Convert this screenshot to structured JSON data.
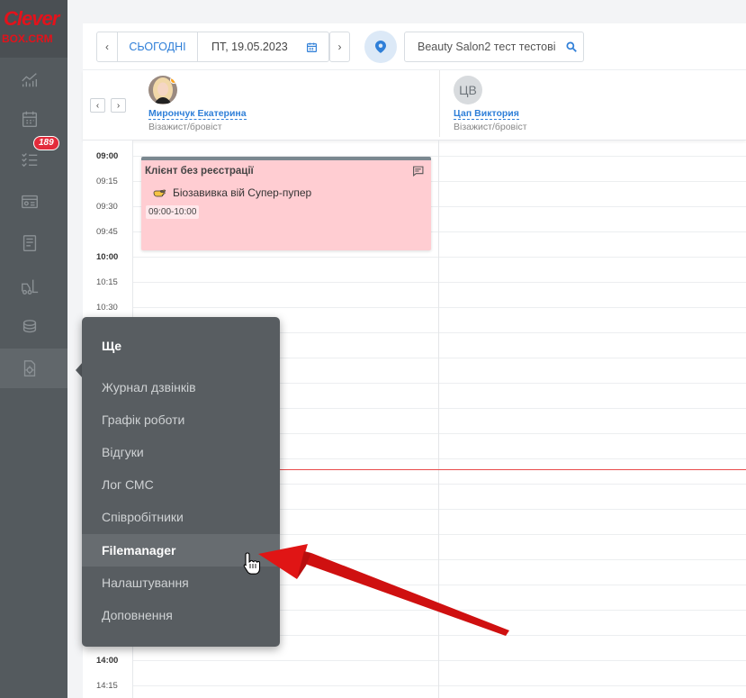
{
  "brand": {
    "line1": "Clever",
    "line2": "BOX.CRM",
    "color": "#e3121b"
  },
  "sidebar": {
    "items": [
      {
        "icon": "analytics-icon"
      },
      {
        "icon": "calendar-icon"
      },
      {
        "icon": "task-list-icon",
        "badge": "189"
      },
      {
        "icon": "contact-card-icon"
      },
      {
        "icon": "notebook-icon"
      },
      {
        "icon": "forklift-icon"
      },
      {
        "icon": "coins-icon"
      },
      {
        "icon": "document-gear-icon",
        "active": true
      }
    ]
  },
  "toolbar": {
    "prev": "‹",
    "today": "СЬОГОДНІ",
    "date": "ПТ, 19.05.2023",
    "next": "›",
    "location": "location-pin-icon",
    "search_value": "Beauty Salon2 тест тестові"
  },
  "staff_nav": {
    "prev": "‹",
    "next": "›"
  },
  "staff": [
    {
      "name": "Мирончук Екатерина",
      "role": "Візажист/бровіст",
      "avatar": "photo"
    },
    {
      "name": "Цап Виктория",
      "role": "Візажист/бровіст",
      "initials": "ЦВ"
    }
  ],
  "times": [
    "09:00",
    "09:15",
    "09:30",
    "09:45",
    "10:00",
    "10:15",
    "10:30"
  ],
  "times_bottom": [
    "14:00",
    "14:15"
  ],
  "appointment": {
    "client": "Клієнт без реєстрації",
    "service": "Біозавивка вій Супер-пупер",
    "time": "09:00-10:00",
    "color": "#ffcdd2"
  },
  "menu": {
    "title": "Ще",
    "items": [
      {
        "label": "Журнал дзвінків"
      },
      {
        "label": "Графік роботи"
      },
      {
        "label": "Відгуки"
      },
      {
        "label": "Лог СМС"
      },
      {
        "label": "Співробітники"
      },
      {
        "label": "Filemanager",
        "highlighted": true
      },
      {
        "label": "Налаштування"
      },
      {
        "label": "Доповнення"
      }
    ]
  }
}
